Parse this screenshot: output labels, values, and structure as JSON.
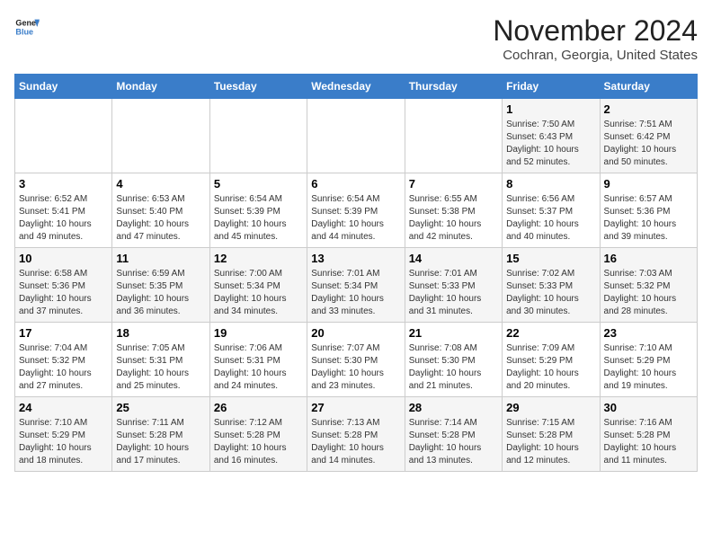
{
  "header": {
    "logo_line1": "General",
    "logo_line2": "Blue",
    "title": "November 2024",
    "subtitle": "Cochran, Georgia, United States"
  },
  "weekdays": [
    "Sunday",
    "Monday",
    "Tuesday",
    "Wednesday",
    "Thursday",
    "Friday",
    "Saturday"
  ],
  "weeks": [
    [
      {
        "day": "",
        "info": ""
      },
      {
        "day": "",
        "info": ""
      },
      {
        "day": "",
        "info": ""
      },
      {
        "day": "",
        "info": ""
      },
      {
        "day": "",
        "info": ""
      },
      {
        "day": "1",
        "info": "Sunrise: 7:50 AM\nSunset: 6:43 PM\nDaylight: 10 hours\nand 52 minutes."
      },
      {
        "day": "2",
        "info": "Sunrise: 7:51 AM\nSunset: 6:42 PM\nDaylight: 10 hours\nand 50 minutes."
      }
    ],
    [
      {
        "day": "3",
        "info": "Sunrise: 6:52 AM\nSunset: 5:41 PM\nDaylight: 10 hours\nand 49 minutes."
      },
      {
        "day": "4",
        "info": "Sunrise: 6:53 AM\nSunset: 5:40 PM\nDaylight: 10 hours\nand 47 minutes."
      },
      {
        "day": "5",
        "info": "Sunrise: 6:54 AM\nSunset: 5:39 PM\nDaylight: 10 hours\nand 45 minutes."
      },
      {
        "day": "6",
        "info": "Sunrise: 6:54 AM\nSunset: 5:39 PM\nDaylight: 10 hours\nand 44 minutes."
      },
      {
        "day": "7",
        "info": "Sunrise: 6:55 AM\nSunset: 5:38 PM\nDaylight: 10 hours\nand 42 minutes."
      },
      {
        "day": "8",
        "info": "Sunrise: 6:56 AM\nSunset: 5:37 PM\nDaylight: 10 hours\nand 40 minutes."
      },
      {
        "day": "9",
        "info": "Sunrise: 6:57 AM\nSunset: 5:36 PM\nDaylight: 10 hours\nand 39 minutes."
      }
    ],
    [
      {
        "day": "10",
        "info": "Sunrise: 6:58 AM\nSunset: 5:36 PM\nDaylight: 10 hours\nand 37 minutes."
      },
      {
        "day": "11",
        "info": "Sunrise: 6:59 AM\nSunset: 5:35 PM\nDaylight: 10 hours\nand 36 minutes."
      },
      {
        "day": "12",
        "info": "Sunrise: 7:00 AM\nSunset: 5:34 PM\nDaylight: 10 hours\nand 34 minutes."
      },
      {
        "day": "13",
        "info": "Sunrise: 7:01 AM\nSunset: 5:34 PM\nDaylight: 10 hours\nand 33 minutes."
      },
      {
        "day": "14",
        "info": "Sunrise: 7:01 AM\nSunset: 5:33 PM\nDaylight: 10 hours\nand 31 minutes."
      },
      {
        "day": "15",
        "info": "Sunrise: 7:02 AM\nSunset: 5:33 PM\nDaylight: 10 hours\nand 30 minutes."
      },
      {
        "day": "16",
        "info": "Sunrise: 7:03 AM\nSunset: 5:32 PM\nDaylight: 10 hours\nand 28 minutes."
      }
    ],
    [
      {
        "day": "17",
        "info": "Sunrise: 7:04 AM\nSunset: 5:32 PM\nDaylight: 10 hours\nand 27 minutes."
      },
      {
        "day": "18",
        "info": "Sunrise: 7:05 AM\nSunset: 5:31 PM\nDaylight: 10 hours\nand 25 minutes."
      },
      {
        "day": "19",
        "info": "Sunrise: 7:06 AM\nSunset: 5:31 PM\nDaylight: 10 hours\nand 24 minutes."
      },
      {
        "day": "20",
        "info": "Sunrise: 7:07 AM\nSunset: 5:30 PM\nDaylight: 10 hours\nand 23 minutes."
      },
      {
        "day": "21",
        "info": "Sunrise: 7:08 AM\nSunset: 5:30 PM\nDaylight: 10 hours\nand 21 minutes."
      },
      {
        "day": "22",
        "info": "Sunrise: 7:09 AM\nSunset: 5:29 PM\nDaylight: 10 hours\nand 20 minutes."
      },
      {
        "day": "23",
        "info": "Sunrise: 7:10 AM\nSunset: 5:29 PM\nDaylight: 10 hours\nand 19 minutes."
      }
    ],
    [
      {
        "day": "24",
        "info": "Sunrise: 7:10 AM\nSunset: 5:29 PM\nDaylight: 10 hours\nand 18 minutes."
      },
      {
        "day": "25",
        "info": "Sunrise: 7:11 AM\nSunset: 5:28 PM\nDaylight: 10 hours\nand 17 minutes."
      },
      {
        "day": "26",
        "info": "Sunrise: 7:12 AM\nSunset: 5:28 PM\nDaylight: 10 hours\nand 16 minutes."
      },
      {
        "day": "27",
        "info": "Sunrise: 7:13 AM\nSunset: 5:28 PM\nDaylight: 10 hours\nand 14 minutes."
      },
      {
        "day": "28",
        "info": "Sunrise: 7:14 AM\nSunset: 5:28 PM\nDaylight: 10 hours\nand 13 minutes."
      },
      {
        "day": "29",
        "info": "Sunrise: 7:15 AM\nSunset: 5:28 PM\nDaylight: 10 hours\nand 12 minutes."
      },
      {
        "day": "30",
        "info": "Sunrise: 7:16 AM\nSunset: 5:28 PM\nDaylight: 10 hours\nand 11 minutes."
      }
    ]
  ]
}
